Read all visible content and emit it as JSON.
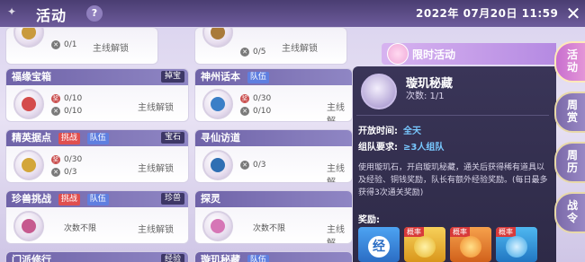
{
  "header": {
    "title": "活动",
    "help_icon": "?",
    "datetime": "2022年 07月20日 11:59",
    "close_icon": "✕"
  },
  "activities": [
    {
      "name": "",
      "stat1": "0/1",
      "stat2": "",
      "unlock": "主线解锁",
      "partial": "top"
    },
    {
      "name": "",
      "stat1": "0/5",
      "stat2": "",
      "unlock": "主线解锁",
      "partial": "top"
    },
    {
      "name": "福缘宝箱",
      "tags": [],
      "drop": "掉宝",
      "stat1": "0/10",
      "stat2": "0/10",
      "unlock": "主线解锁"
    },
    {
      "name": "神州话本",
      "tags": [
        "队伍"
      ],
      "drop": "",
      "stat1": "0/30",
      "stat2": "0/10",
      "unlock": "主线解"
    },
    {
      "name": "精英据点",
      "tags": [
        "挑战",
        "队伍"
      ],
      "drop": "宝石",
      "stat1": "0/30",
      "stat2": "0/3",
      "unlock": "主线解锁"
    },
    {
      "name": "寻仙访道",
      "tags": [],
      "drop": "",
      "stat1": "0/3",
      "stat2": "",
      "unlock": "主线解"
    },
    {
      "name": "珍兽挑战",
      "tags": [
        "挑战",
        "队伍"
      ],
      "drop": "珍兽",
      "stat1": "次数不限",
      "stat2": "",
      "unlock": "主线解锁"
    },
    {
      "name": "探灵",
      "tags": [],
      "drop": "",
      "stat1": "次数不限",
      "stat2": "",
      "unlock": "主线解"
    },
    {
      "name": "门派修行",
      "tags": [],
      "drop": "经验",
      "partial": "bottom"
    },
    {
      "name": "璇玑秘藏",
      "tags": [
        "队伍"
      ],
      "drop": "",
      "partial": "bottom"
    }
  ],
  "detail": {
    "band_label": "限时活动",
    "title": "璇玑秘藏",
    "count_label": "次数: 1/1",
    "open_time_label": "开放时间:",
    "open_time_value": "全天",
    "team_req_label": "组队要求:",
    "team_req_value": "≥3人组队",
    "description": "使用璇玑石，开启璇玑秘藏，通关后获得稀有道具以及经验、铜钱奖励，队长有额外经验奖励。(每日最多获得3次通关奖励)",
    "reward_label": "奖励:",
    "rewards": [
      {
        "name": "经",
        "rate": "",
        "color": "#3f8fe8"
      },
      {
        "name": "",
        "rate": "概率",
        "color": "#f1c23b"
      },
      {
        "name": "",
        "rate": "概率",
        "color": "#f08a2b"
      },
      {
        "name": "",
        "rate": "概率",
        "color": "#39a5e6"
      }
    ]
  },
  "side_tabs": [
    {
      "label": "活动",
      "active": true
    },
    {
      "label": "周赏",
      "active": false
    },
    {
      "label": "周历",
      "active": false
    },
    {
      "label": "战令",
      "active": false
    }
  ]
}
